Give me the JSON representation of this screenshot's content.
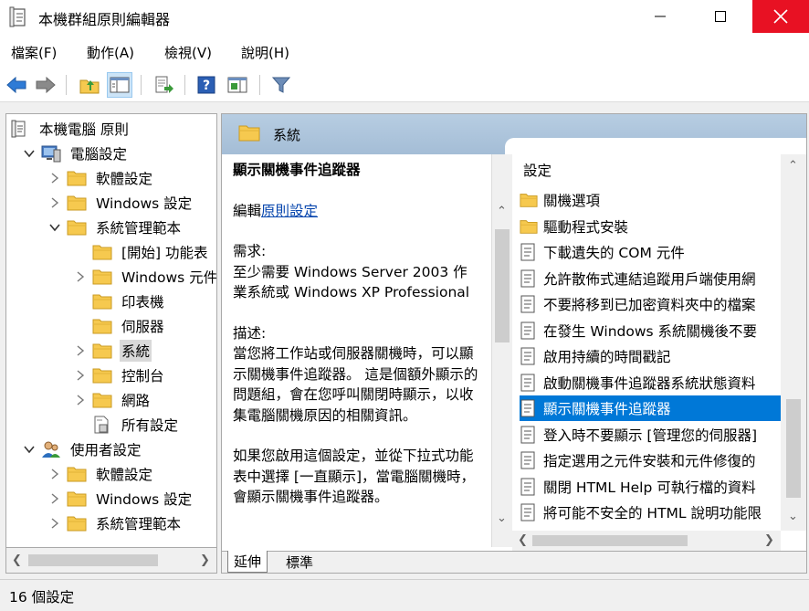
{
  "window": {
    "title": "本機群組原則編輯器"
  },
  "menu": [
    {
      "label": "檔案(F)"
    },
    {
      "label": "動作(A)"
    },
    {
      "label": "檢視(V)"
    },
    {
      "label": "說明(H)"
    }
  ],
  "toolbar": {
    "icons": [
      "back-icon",
      "forward-icon",
      "up-folder-icon",
      "show-hide-tree-icon",
      "export-list-icon",
      "help-icon",
      "extended-view-icon",
      "filter-icon"
    ]
  },
  "tree": {
    "items": [
      {
        "label": "本機電腦 原則",
        "icon": "policy-icon",
        "indent": 0,
        "expander": ""
      },
      {
        "label": "電腦設定",
        "icon": "computer-icon",
        "indent": 1,
        "expander": "open"
      },
      {
        "label": "軟體設定",
        "icon": "folder-icon",
        "indent": 2,
        "expander": "closed"
      },
      {
        "label": "Windows 設定",
        "icon": "folder-icon",
        "indent": 2,
        "expander": "closed"
      },
      {
        "label": "系統管理範本",
        "icon": "folder-icon",
        "indent": 2,
        "expander": "open"
      },
      {
        "label": "[開始] 功能表",
        "icon": "folder-icon",
        "indent": 3,
        "expander": ""
      },
      {
        "label": "Windows 元件",
        "icon": "folder-icon",
        "indent": 3,
        "expander": "closed"
      },
      {
        "label": "印表機",
        "icon": "folder-icon",
        "indent": 3,
        "expander": ""
      },
      {
        "label": "伺服器",
        "icon": "folder-icon",
        "indent": 3,
        "expander": ""
      },
      {
        "label": "系統",
        "icon": "folder-icon",
        "indent": 3,
        "expander": "closed",
        "selected": true
      },
      {
        "label": "控制台",
        "icon": "folder-icon",
        "indent": 3,
        "expander": "closed"
      },
      {
        "label": "網路",
        "icon": "folder-icon",
        "indent": 3,
        "expander": "closed"
      },
      {
        "label": "所有設定",
        "icon": "settings-page-icon",
        "indent": 3,
        "expander": ""
      },
      {
        "label": "使用者設定",
        "icon": "users-icon",
        "indent": 1,
        "expander": "open"
      },
      {
        "label": "軟體設定",
        "icon": "folder-icon",
        "indent": 2,
        "expander": "closed"
      },
      {
        "label": "Windows 設定",
        "icon": "folder-icon",
        "indent": 2,
        "expander": "closed"
      },
      {
        "label": "系統管理範本",
        "icon": "folder-icon",
        "indent": 2,
        "expander": "closed"
      }
    ]
  },
  "header": {
    "title": "系統"
  },
  "description": {
    "title": "顯示關機事件追蹤器",
    "edit_prefix": "編輯",
    "edit_link": "原則設定",
    "req_label": "需求:",
    "req_text": "至少需要 Windows Server 2003 作業系統或 Windows XP Professional",
    "desc_label": "描述:",
    "desc_text": "當您將工作站或伺服器關機時，可以顯示關機事件追蹤器。 這是個額外顯示的問題組，會在您呼叫關閉時顯示，以收集電腦關機原因的相關資訊。",
    "desc_text2": "如果您啟用這個設定，並從下拉式功能表中選擇 [一直顯示]，當電腦關機時，會顯示關機事件追蹤器。"
  },
  "settings_list": {
    "column_header": "設定",
    "items": [
      {
        "label": "關機選項",
        "icon": "folder-icon"
      },
      {
        "label": "驅動程式安裝",
        "icon": "folder-icon"
      },
      {
        "label": "下載遺失的 COM 元件",
        "icon": "setting-icon"
      },
      {
        "label": "允許散佈式連結追蹤用戶端使用網",
        "icon": "setting-icon"
      },
      {
        "label": "不要將移到已加密資料夾中的檔案",
        "icon": "setting-icon"
      },
      {
        "label": "在發生 Windows 系統關機後不要",
        "icon": "setting-icon"
      },
      {
        "label": "啟用持續的時間戳記",
        "icon": "setting-icon"
      },
      {
        "label": "啟動關機事件追蹤器系統狀態資料",
        "icon": "setting-icon"
      },
      {
        "label": "顯示關機事件追蹤器",
        "icon": "setting-icon",
        "selected": true
      },
      {
        "label": "登入時不要顯示 [管理您的伺服器]",
        "icon": "setting-icon"
      },
      {
        "label": "指定選用之元件安裝和元件修復的",
        "icon": "setting-icon"
      },
      {
        "label": "關閉 HTML Help 可執行檔的資料",
        "icon": "setting-icon"
      },
      {
        "label": "將可能不安全的 HTML 說明功能限",
        "icon": "setting-icon"
      }
    ]
  },
  "tabs": [
    {
      "label": "延伸"
    },
    {
      "label": "標準"
    }
  ],
  "status": {
    "text": "16 個設定"
  },
  "colors": {
    "selection": "#0078d7",
    "close_button": "#e81123",
    "header_band": "#a4bdd6",
    "link": "#0645ad"
  }
}
